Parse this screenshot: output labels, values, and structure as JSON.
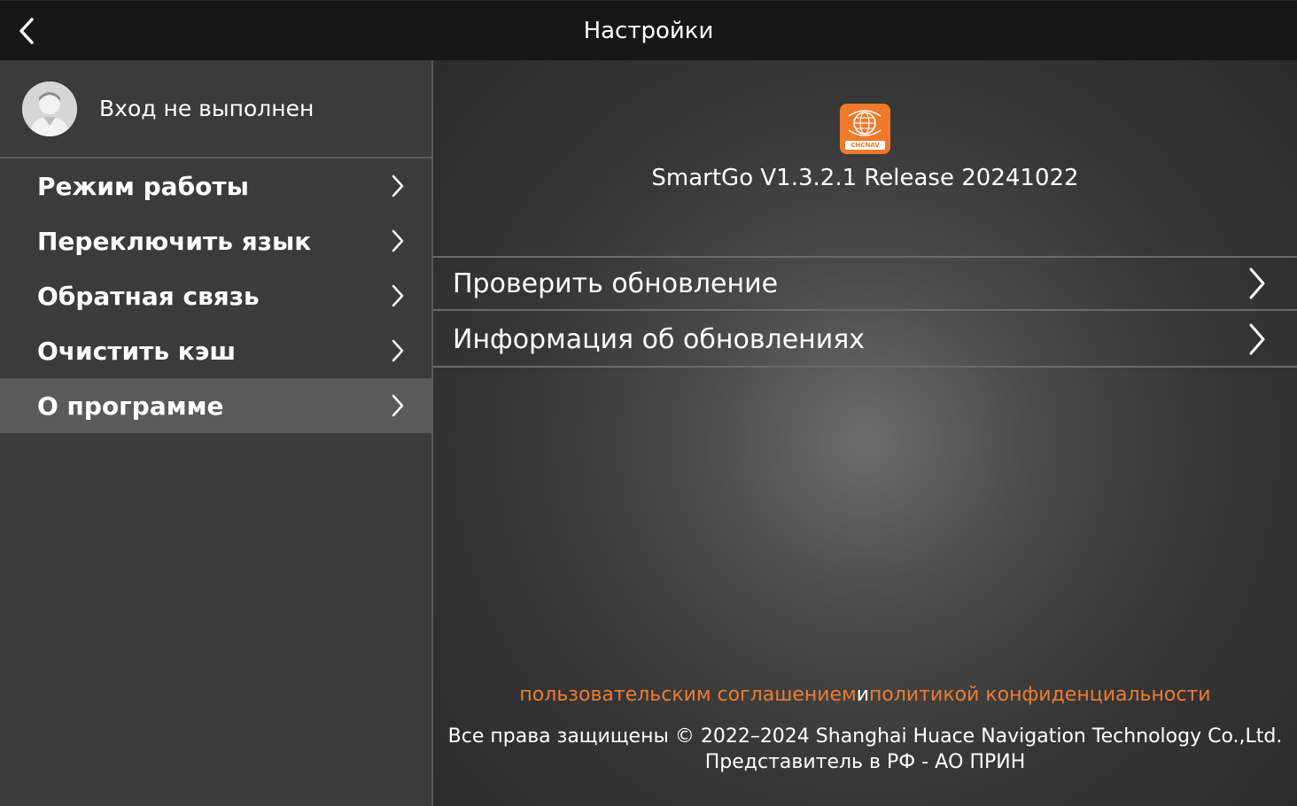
{
  "header": {
    "title": "Настройки",
    "back_icon": "chevron-left-icon"
  },
  "sidebar": {
    "profile": {
      "label": "Вход не выполнен",
      "avatar_icon": "user-avatar-icon"
    },
    "items": [
      {
        "label": "Режим работы",
        "active": false
      },
      {
        "label": "Переключить язык",
        "active": false
      },
      {
        "label": "Обратная связь",
        "active": false
      },
      {
        "label": "Очистить кэш",
        "active": false
      },
      {
        "label": "О программе",
        "active": true
      }
    ]
  },
  "main": {
    "logo": {
      "text": "CHCNAV",
      "icon": "app-logo-icon"
    },
    "version": "SmartGo V1.3.2.1 Release 20241022",
    "rows": [
      {
        "label": "Проверить обновление"
      },
      {
        "label": "Информация об обновлениях"
      }
    ],
    "legal": {
      "agreement_link": "пользовательским соглашением",
      "conjunction": "и",
      "privacy_link": "политикой конфиденциальности"
    },
    "copyright": "Все права защищены © 2022–2024 Shanghai Huace Navigation Technology Co.,Ltd.",
    "representative": "Представитель в РФ - АО ПРИН"
  },
  "colors": {
    "topbar": "#171717",
    "sidebar": "#3b3b3b",
    "active_item": "#5a5a5a",
    "accent": "#ee7b2f",
    "logo_bg": "#ef7a2a"
  }
}
